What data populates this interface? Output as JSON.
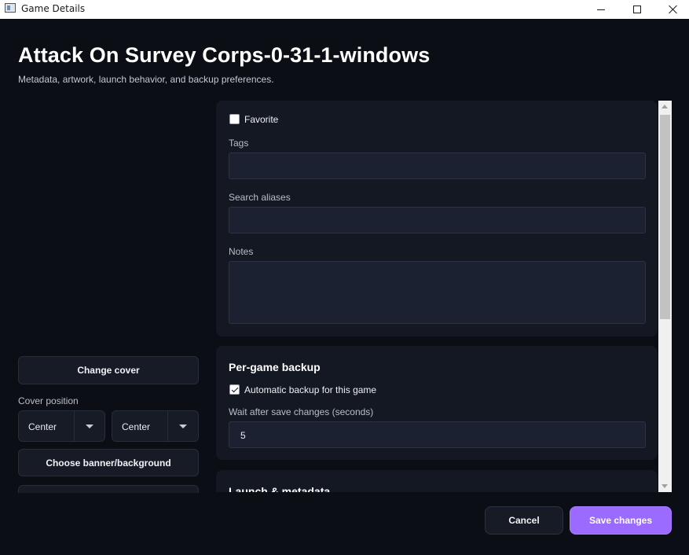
{
  "window": {
    "title": "Game Details"
  },
  "header": {
    "title": "Attack On Survey Corps-0-31-1-windows",
    "subtitle": "Metadata, artwork, launch behavior, and backup preferences."
  },
  "left_panel": {
    "change_cover_label": "Change cover",
    "cover_position_label": "Cover position",
    "cover_position_x": "Center",
    "cover_position_y": "Center",
    "choose_banner_label": "Choose banner/background"
  },
  "details_card": {
    "favorite_label": "Favorite",
    "favorite_checked": false,
    "tags_label": "Tags",
    "tags_value": "",
    "aliases_label": "Search aliases",
    "aliases_value": "",
    "notes_label": "Notes",
    "notes_value": ""
  },
  "backup_card": {
    "title": "Per-game backup",
    "auto_backup_label": "Automatic backup for this game",
    "auto_backup_checked": true,
    "wait_label": "Wait after save changes (seconds)",
    "wait_value": "5"
  },
  "launch_card": {
    "title": "Launch & metadata"
  },
  "footer": {
    "cancel_label": "Cancel",
    "save_label": "Save changes"
  },
  "colors": {
    "background": "#0b0e14",
    "card": "#131822",
    "accent": "#9b6bff"
  }
}
